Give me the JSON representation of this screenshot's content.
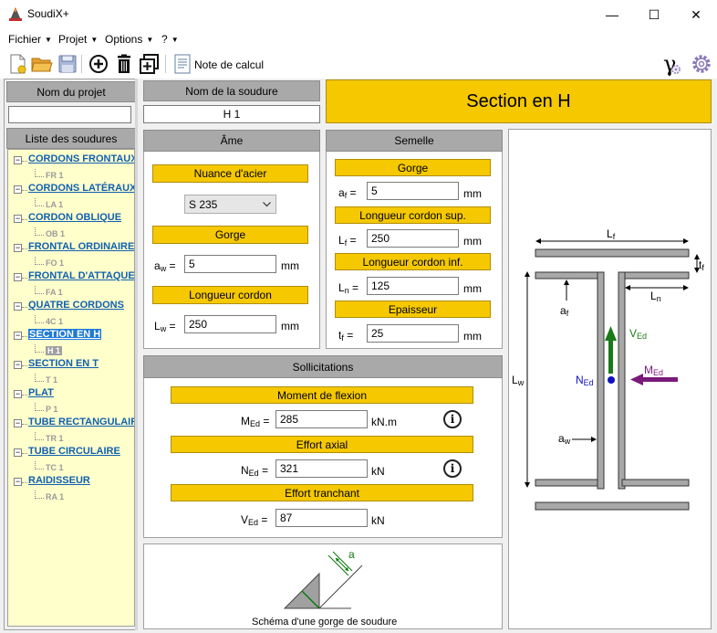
{
  "window": {
    "title": "SoudiX+",
    "minimize": "—",
    "maximize": "☐",
    "close": "✕"
  },
  "menu": {
    "items": [
      "Fichier",
      "Projet",
      "Options",
      "?"
    ]
  },
  "toolbar": {
    "note_label": "Note de calcul",
    "gamma": "γ"
  },
  "left": {
    "project_header": "Nom du projet",
    "project_value": "",
    "list_header": "Liste des soudures",
    "tree": [
      {
        "label": "CORDONS FRONTAUX",
        "child": "FR 1"
      },
      {
        "label": "CORDONS LATÉRAUX",
        "child": "LA 1"
      },
      {
        "label": "CORDON OBLIQUE",
        "child": "OB 1"
      },
      {
        "label": "FRONTAL ORDINAIRE",
        "child": "FO 1"
      },
      {
        "label": "FRONTAL D'ATTAQUE",
        "child": "FA 1"
      },
      {
        "label": "QUATRE CORDONS",
        "child": "4C 1"
      },
      {
        "label": "SECTION EN H",
        "child": "H 1"
      },
      {
        "label": "SECTION EN T",
        "child": "T 1"
      },
      {
        "label": "PLAT",
        "child": "P 1"
      },
      {
        "label": "TUBE RECTANGULAIRE",
        "child": "TR 1"
      },
      {
        "label": "TUBE CIRCULAIRE",
        "child": "TC 1"
      },
      {
        "label": "RAIDISSEUR",
        "child": "RA 1"
      }
    ]
  },
  "weld": {
    "name_header": "Nom de la soudure",
    "name_value": "H 1",
    "section_title": "Section en H"
  },
  "ame": {
    "header": "Âme",
    "steel_label": "Nuance d'acier",
    "steel_value": "S 235",
    "gorge_label": "Gorge",
    "aw_label": "a",
    "aw_sub": "w",
    "aw_value": "5",
    "aw_unit": "mm",
    "length_label": "Longueur cordon",
    "lw_label": "L",
    "lw_sub": "w",
    "lw_value": "250",
    "lw_unit": "mm"
  },
  "semelle": {
    "header": "Semelle",
    "gorge_label": "Gorge",
    "af_label": "a",
    "af_sub": "f",
    "af_value": "5",
    "af_unit": "mm",
    "sup_label": "Longueur cordon sup.",
    "lf_label": "L",
    "lf_sub": "f",
    "lf_value": "250",
    "lf_unit": "mm",
    "inf_label": "Longueur cordon inf.",
    "ln_label": "L",
    "ln_sub": "n",
    "ln_value": "125",
    "ln_unit": "mm",
    "thick_label": "Epaisseur",
    "tf_label": "t",
    "tf_sub": "f",
    "tf_value": "25",
    "tf_unit": "mm"
  },
  "loads": {
    "header": "Sollicitations",
    "moment_label": "Moment de flexion",
    "med_label": "M",
    "med_sub": "Ed",
    "med_value": "285",
    "med_unit": "kN.m",
    "axial_label": "Effort axial",
    "ned_label": "N",
    "ned_sub": "Ed",
    "ned_value": "321",
    "ned_unit": "kN",
    "shear_label": "Effort tranchant",
    "ved_label": "V",
    "ved_sub": "Ed",
    "ved_value": "87",
    "ved_unit": "kN",
    "info": "i"
  },
  "schema": {
    "caption": "Schéma d'une gorge de soudure",
    "a_label": "a"
  },
  "diagram": {
    "lf": "L",
    "lf_sub": "f",
    "tf": "t",
    "tf_sub": "f",
    "ln": "L",
    "ln_sub": "n",
    "af": "a",
    "af_sub": "f",
    "lw": "L",
    "lw_sub": "w",
    "aw": "a",
    "aw_sub": "w",
    "ved": "V",
    "ved_sub": "Ed",
    "ned": "N",
    "ned_sub": "Ed",
    "med": "M",
    "med_sub": "Ed",
    "colors": {
      "ved": "#1a7a1a",
      "ned": "#1010c0",
      "med": "#7a1a7a"
    }
  }
}
